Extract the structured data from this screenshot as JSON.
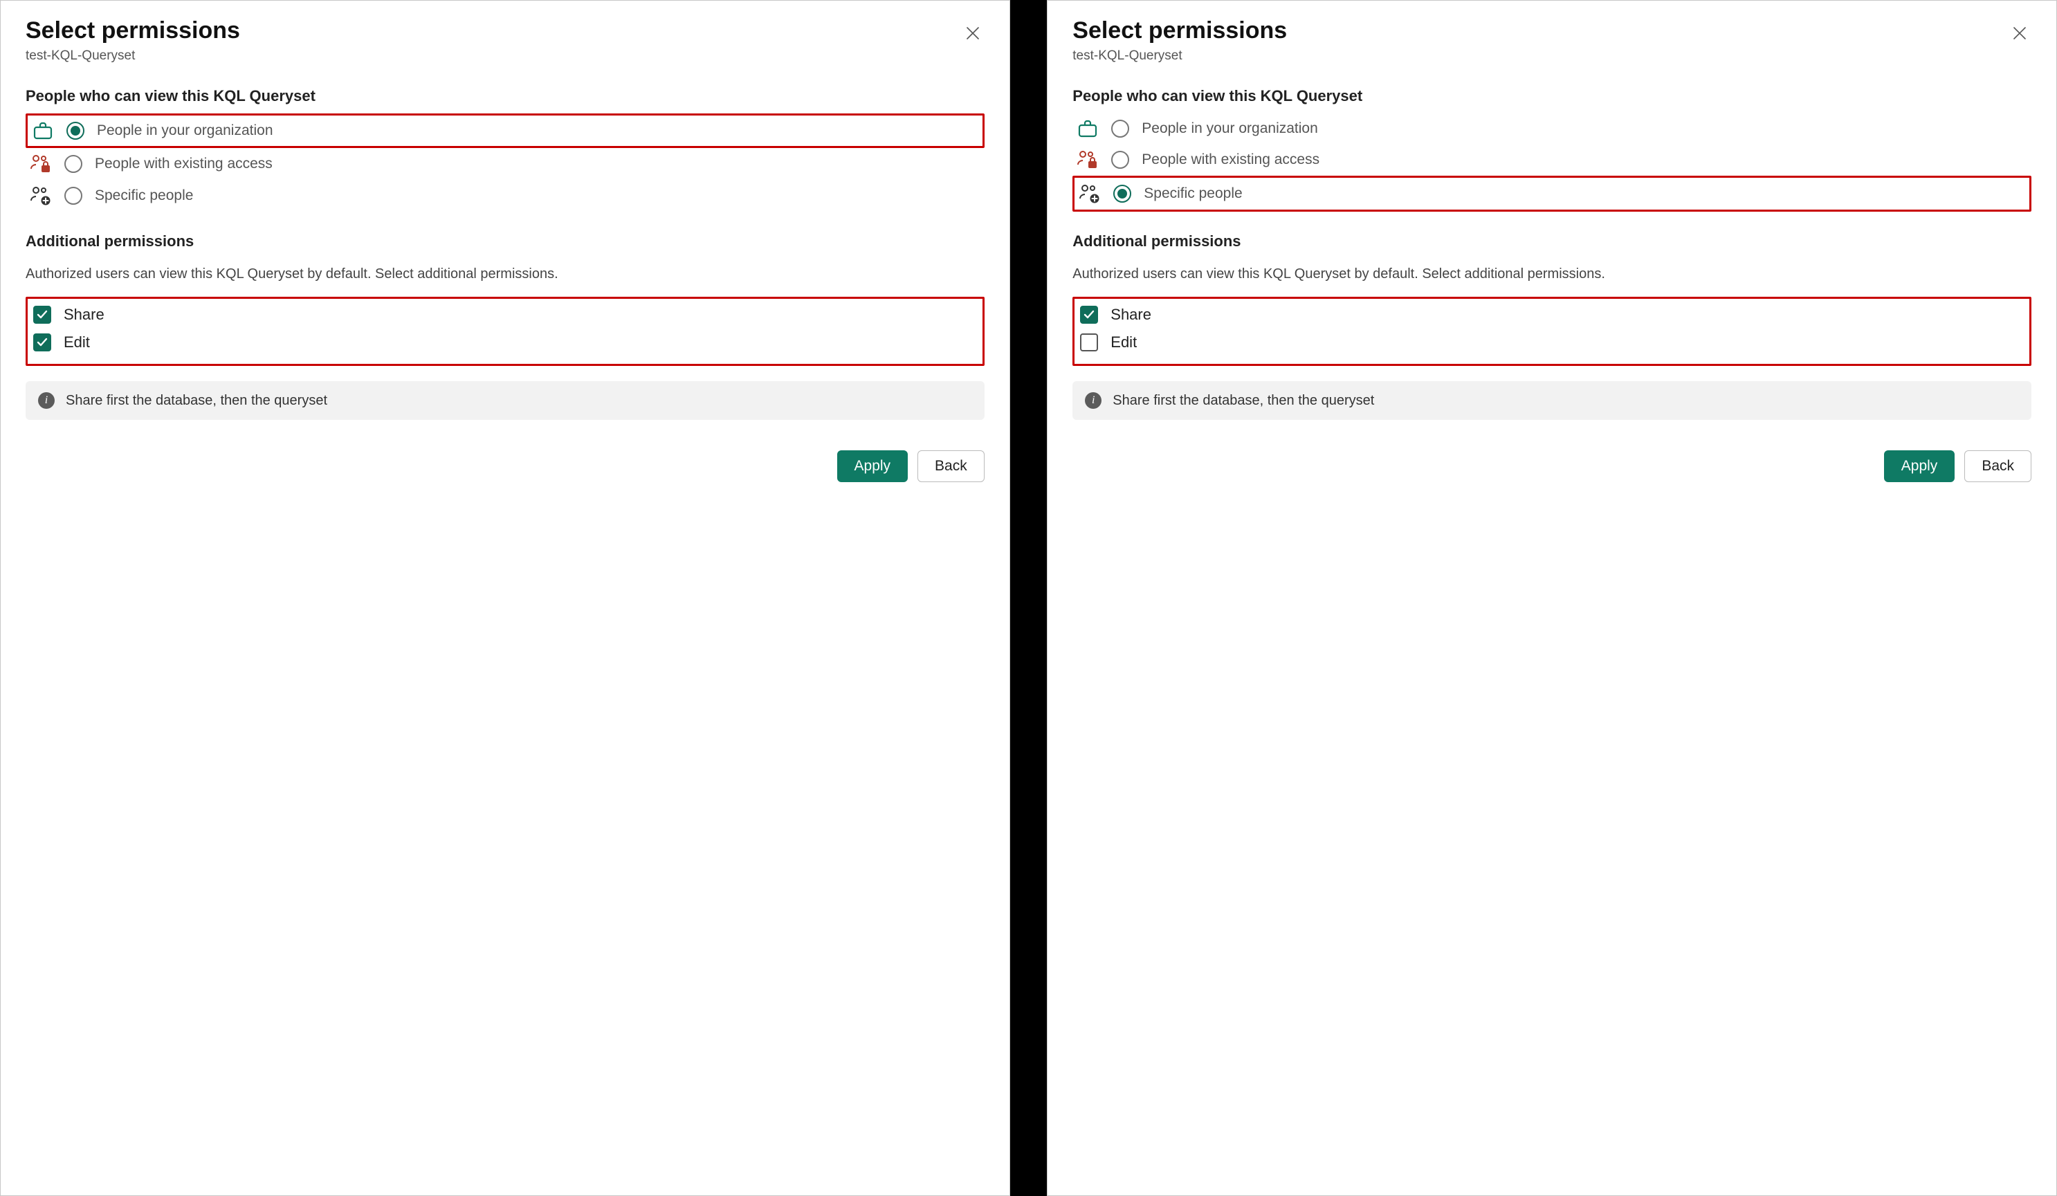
{
  "title": "Select permissions",
  "subtitle": "test-KQL-Queryset",
  "viewers_section_label": "People who can view this KQL Queryset",
  "options": {
    "org": {
      "label": "People in your organization"
    },
    "existing": {
      "label": "People with existing access"
    },
    "specific": {
      "label": "Specific people"
    }
  },
  "additional_section_label": "Additional permissions",
  "additional_desc": "Authorized users can view this KQL Queryset by default. Select additional permissions.",
  "checkboxes": {
    "share": {
      "label": "Share"
    },
    "edit": {
      "label": "Edit"
    }
  },
  "info_text": "Share first the database, then the queryset",
  "buttons": {
    "apply": "Apply",
    "back": "Back"
  },
  "panels": [
    {
      "selected_option": "org",
      "highlight_option": "org",
      "share_checked": true,
      "edit_checked": true
    },
    {
      "selected_option": "specific",
      "highlight_option": "specific",
      "share_checked": true,
      "edit_checked": false
    }
  ]
}
